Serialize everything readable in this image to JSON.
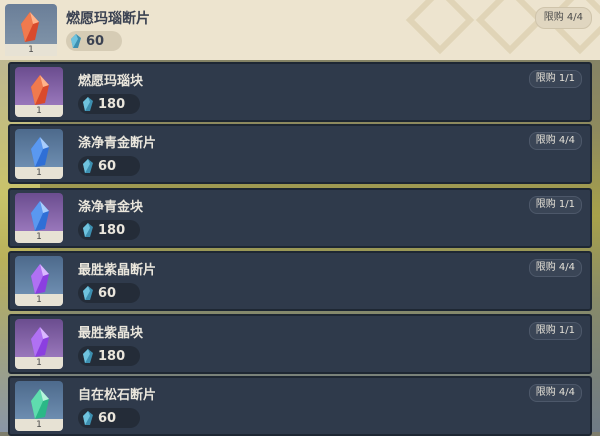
{
  "colors": {
    "top_bg": "#ede4cf",
    "row_bg": "#2f3a4b",
    "gem_red": "#d94a2c",
    "gem_blue": "#2f6fd6",
    "gem_purple": "#8b3fe0",
    "gem_green": "#2bb887",
    "currency_cyan": "#5fd0e6"
  },
  "selected_item": {
    "name": "燃愿玛瑙断片",
    "limit": "限购 4/4",
    "price": "60",
    "quantity": "1",
    "gem": "red"
  },
  "items": [
    {
      "name": "燃愿玛瑙块",
      "limit": "限购 1/1",
      "price": "180",
      "quantity": "1",
      "gem": "red"
    },
    {
      "name": "涤净青金断片",
      "limit": "限购 4/4",
      "price": "60",
      "quantity": "1",
      "gem": "blue"
    },
    {
      "name": "涤净青金块",
      "limit": "限购 1/1",
      "price": "180",
      "quantity": "1",
      "gem": "blue"
    },
    {
      "name": "最胜紫晶断片",
      "limit": "限购 4/4",
      "price": "60",
      "quantity": "1",
      "gem": "purple"
    },
    {
      "name": "最胜紫晶块",
      "limit": "限购 1/1",
      "price": "180",
      "quantity": "1",
      "gem": "purple"
    },
    {
      "name": "自在松石断片",
      "limit": "限购 4/4",
      "price": "60",
      "quantity": "1",
      "gem": "green"
    }
  ]
}
